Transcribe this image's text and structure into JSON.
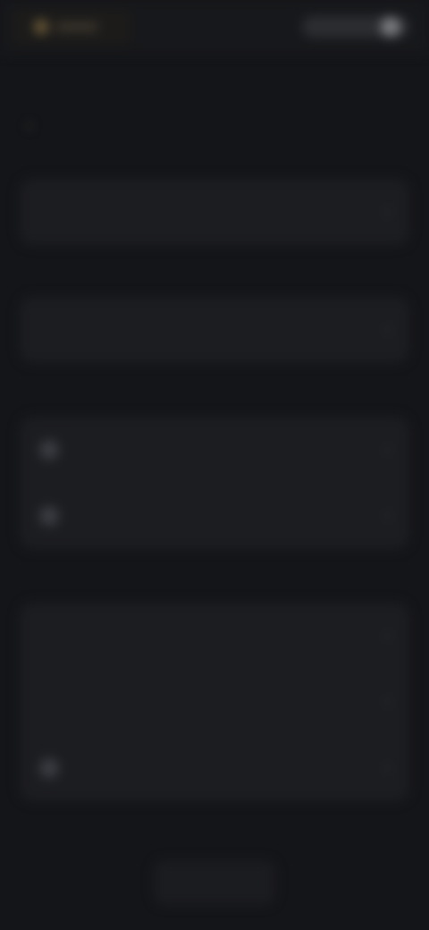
{
  "status_bar": {
    "brand": "",
    "right": ""
  },
  "header": {
    "title": "",
    "back_icon": "chevron-left-icon"
  },
  "sections": [
    {
      "label": "",
      "rows": [
        {
          "label": "",
          "value": ""
        }
      ]
    },
    {
      "label": "",
      "rows": [
        {
          "label": "",
          "value": ""
        }
      ]
    },
    {
      "label": "",
      "rows": [
        {
          "label": "",
          "value": ""
        },
        {
          "label": "",
          "value": ""
        }
      ]
    },
    {
      "label": "",
      "rows": [
        {
          "label": "",
          "value": ""
        },
        {
          "label": "",
          "value": ""
        },
        {
          "label": "",
          "value": ""
        }
      ]
    }
  ],
  "footer": {
    "button_label": ""
  },
  "colors": {
    "background": "#141518",
    "card": "#1c1d21",
    "accent": "#6c5a37"
  }
}
